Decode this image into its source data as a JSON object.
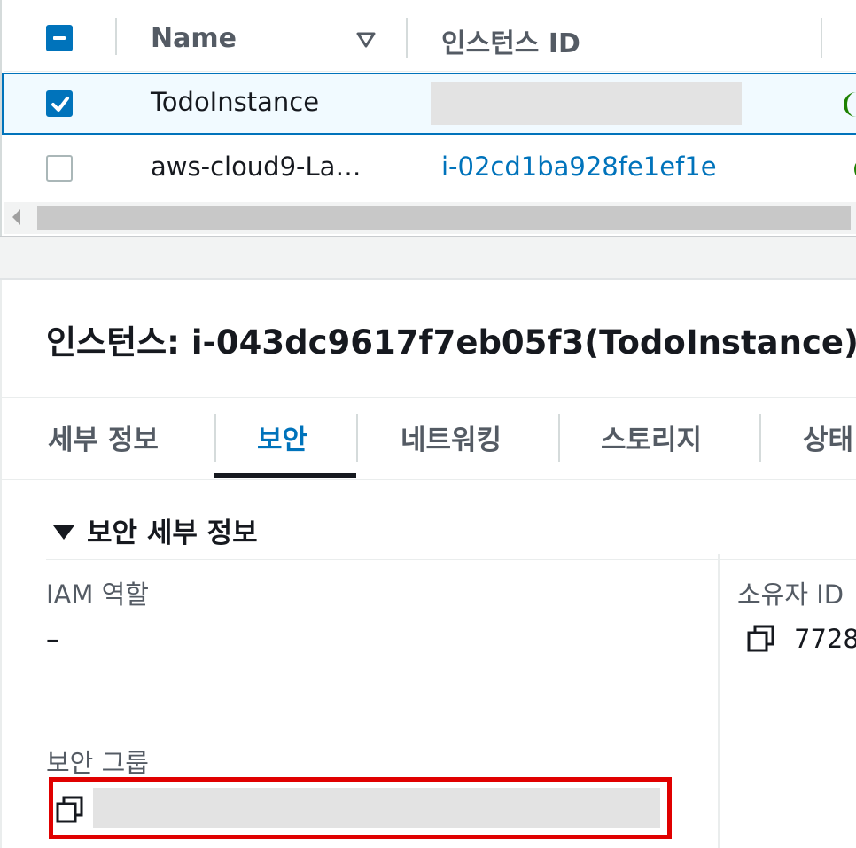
{
  "table": {
    "columns": [
      "Name",
      "인스턴스 ID"
    ],
    "rows": [
      {
        "name": "TodoInstance",
        "instance_id": "",
        "selected": true
      },
      {
        "name": "aws-cloud9-La…",
        "instance_id": "i-02cd1ba928fe1ef1e",
        "selected": false
      }
    ]
  },
  "detail": {
    "title": "인스턴스: i-043dc9617f7eb05f3(TodoInstance)",
    "tabs": [
      "세부 정보",
      "보안",
      "네트워킹",
      "스토리지",
      "상태"
    ],
    "active_tab": "보안",
    "section_title": "보안 세부 정보",
    "iam_role_label": "IAM 역할",
    "iam_role_value": "–",
    "owner_id_label": "소유자 ID",
    "owner_id_value": "7728",
    "security_group_label": "보안 그룹",
    "security_group_value": ""
  },
  "colors": {
    "accent": "#0073bb",
    "highlight": "#e00000",
    "status_green": "#1d8102"
  }
}
